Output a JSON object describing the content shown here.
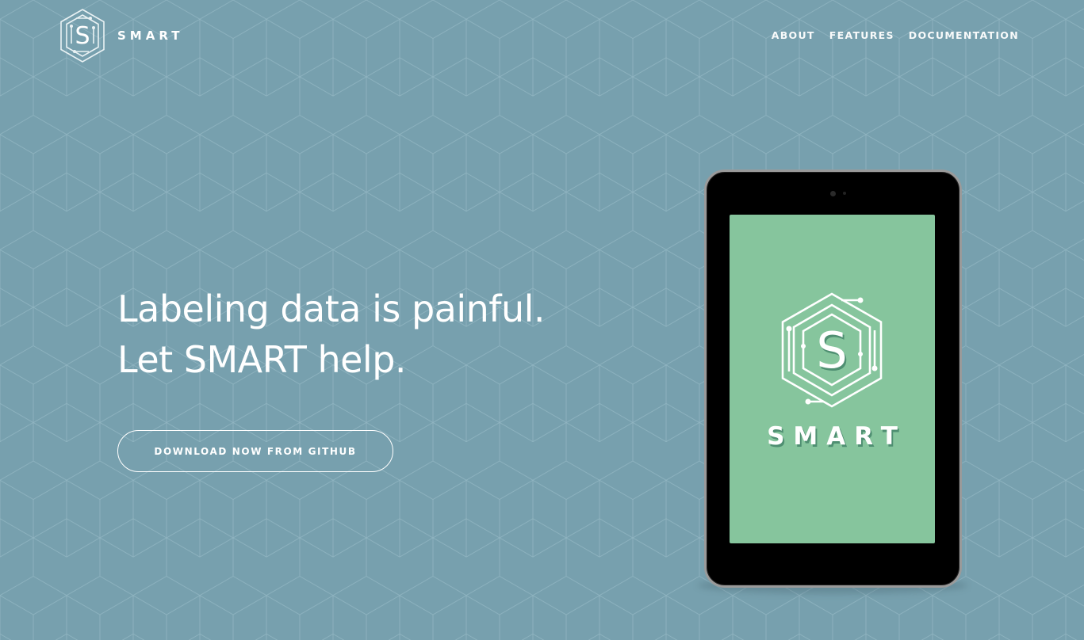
{
  "brand": {
    "name": "SMART",
    "logo_letter": "S",
    "logo_icon": "smart-hexagon-logo"
  },
  "nav": {
    "items": [
      {
        "label": "ABOUT"
      },
      {
        "label": "FEATURES"
      },
      {
        "label": "DOCUMENTATION"
      }
    ]
  },
  "hero": {
    "headline_line1": "Labeling data is painful.",
    "headline_line2": "Let SMART help.",
    "cta_label": "DOWNLOAD NOW FROM GITHUB"
  },
  "device": {
    "type": "tablet",
    "screen_wordmark": "SMART",
    "screen_logo_letter": "S"
  },
  "colors": {
    "background": "#77a0ae",
    "pattern_line": "#93b6c2",
    "screen": "#86c59d",
    "text": "#ffffff"
  }
}
